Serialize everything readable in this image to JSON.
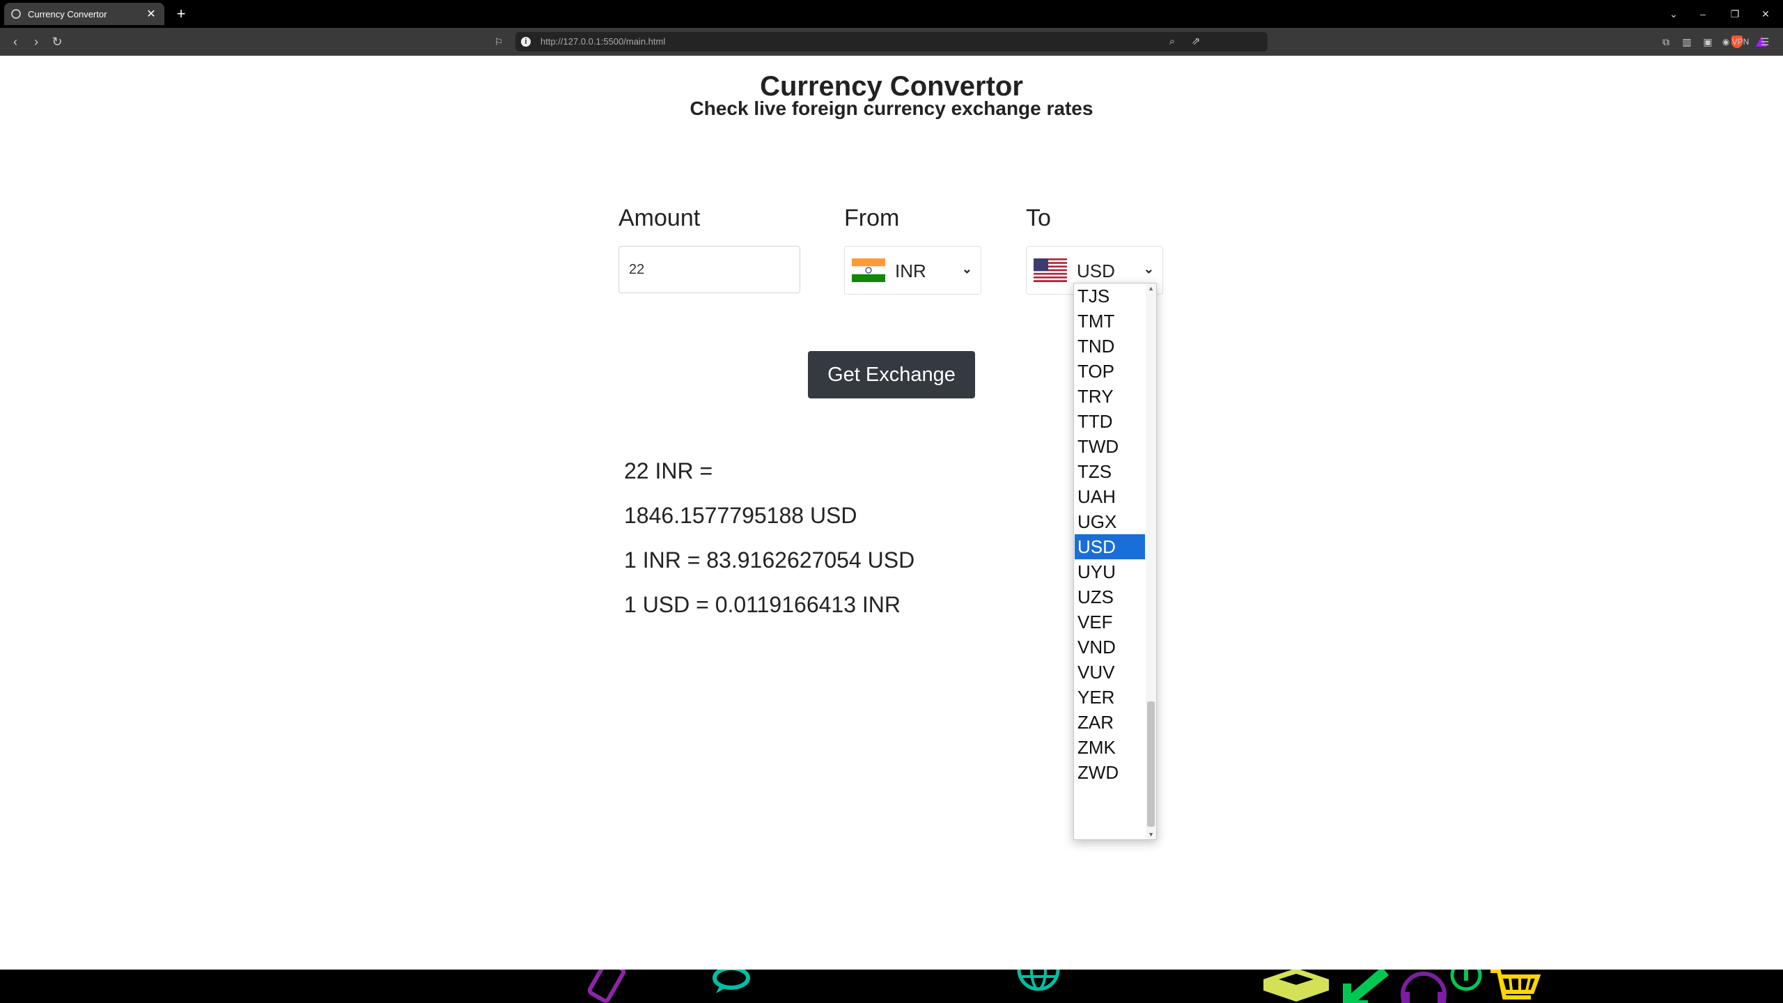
{
  "browser": {
    "tab_title": "Currency Convertor",
    "tab_close": "✕",
    "new_tab": "+",
    "url": "http://127.0.0.1:5500/main.html",
    "info_icon": "i",
    "vpn_label": "VPN",
    "window_controls": {
      "list": "⌄",
      "minimize": "–",
      "restore": "❐",
      "close": "✕"
    },
    "nav": {
      "back": "‹",
      "forward": "›",
      "reload": "↻",
      "bookmark": "⚐"
    }
  },
  "page": {
    "title": "Currency Convertor",
    "subtitle": "Check live foreign currency exchange rates"
  },
  "form": {
    "amount_label": "Amount",
    "amount_value": "22",
    "from_label": "From",
    "from_value": "INR",
    "to_label": "To",
    "to_value": "USD",
    "chevron": "⌄",
    "button_label": "Get Exchange"
  },
  "result": {
    "line1": "22 INR =",
    "line2": "1846.1577795188 USD",
    "line3": "1 INR = 83.9162627054 USD",
    "line4": "1 USD = 0.0119166413 INR"
  },
  "dropdown": {
    "options": [
      "TJS",
      "TMT",
      "TND",
      "TOP",
      "TRY",
      "TTD",
      "TWD",
      "TZS",
      "UAH",
      "UGX",
      "USD",
      "UYU",
      "UZS",
      "VEF",
      "VND",
      "VUV",
      "YER",
      "ZAR",
      "ZMK",
      "ZWD"
    ],
    "selected": "USD",
    "scroll_up": "▲",
    "scroll_down": "▼"
  },
  "colors": {
    "selection": "#1a6ed8",
    "button": "#343a40",
    "taskbar_icons": [
      "#8e24aa",
      "#00bfa5",
      "#00bfa5",
      "#d4e157",
      "#00c853",
      "#7b1fa2",
      "#00c853",
      "#ffd600"
    ]
  },
  "icons": {
    "taskbar": [
      "phone-icon",
      "chat-icon",
      "globe-icon",
      "upload-tray-icon",
      "arrow-icon",
      "headset-icon",
      "info-icon",
      "cart-icon"
    ]
  }
}
